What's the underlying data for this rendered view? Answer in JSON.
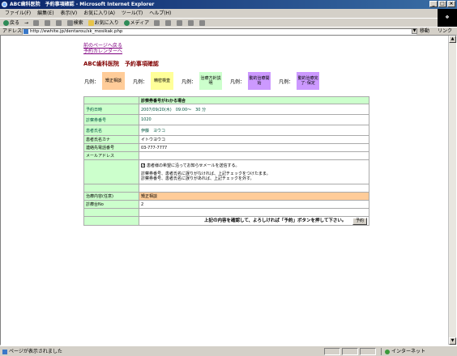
{
  "window": {
    "title": "ABC歯科医院　予約事項確認 - Microsoft Internet Explorer",
    "btn_min": "_",
    "btn_max": "□",
    "btn_close": "×"
  },
  "menu": [
    "ファイル(F)",
    "編集(E)",
    "表示(V)",
    "お気に入り(A)",
    "ツール(T)",
    "ヘルプ(H)"
  ],
  "toolbar": {
    "back": "戻る",
    "forward": "→",
    "search": "検索",
    "favorites": "お気に入り",
    "media": "メディア"
  },
  "address": {
    "label": "アドレス(D)",
    "url": "http://ewhite.jp/dentarou/sk_mosikak.php",
    "go": "移動",
    "links": "リンク"
  },
  "status": {
    "text": "ページが表示されました",
    "zone": "インターネット"
  },
  "page": {
    "link_prev": "前のページへ戻る",
    "link_calendar": "予約カレンダーへ",
    "heading": "ABC歯科医院　予約事項確認",
    "legend_label": "凡例：",
    "legend": [
      "矯正相談",
      "精密検査",
      "治療方針説明",
      "動的治療開始",
      "動的治療完了･保定"
    ],
    "table": {
      "header": "診察券番号がわかる場合",
      "rows": [
        {
          "label": "予約日時",
          "value": "2007/09/20(木)　09:00～　30 分"
        },
        {
          "label": "診察券番号",
          "value": "1020"
        },
        {
          "label": "患者氏名",
          "value": "伊藤　ヨウコ"
        },
        {
          "label": "患者氏名カナ",
          "value": "イトウヨウコ"
        },
        {
          "label": "連絡先電話番号",
          "value": "03-777-7777"
        },
        {
          "label": "メールアドレス",
          "value": ""
        }
      ],
      "mail_check": "患者様の希望に沿ってお知らせメールを送信する。",
      "note1": "診察券番号、患者氏名に誤りがなければ、上記チェックをつけたまま。",
      "note2": "診察券番号、患者氏名に誤りがあれば、上記チェックを外す。",
      "treatment_label": "治療内容(任意)",
      "treatment_value": "矯正相談",
      "chair_label": "診療台No",
      "chair_value": "2",
      "confirm_text": "上記の内容を確認して、よろしければ「予約」ボタンを押して下さい。",
      "submit": "予約"
    }
  },
  "colors": {
    "label_bg": "#ccffcc",
    "orange": "#ffcc99",
    "yellow": "#ffff99",
    "purple": "#cc99ff",
    "heading": "#800000",
    "link": "#800080",
    "value": "#00563f"
  }
}
